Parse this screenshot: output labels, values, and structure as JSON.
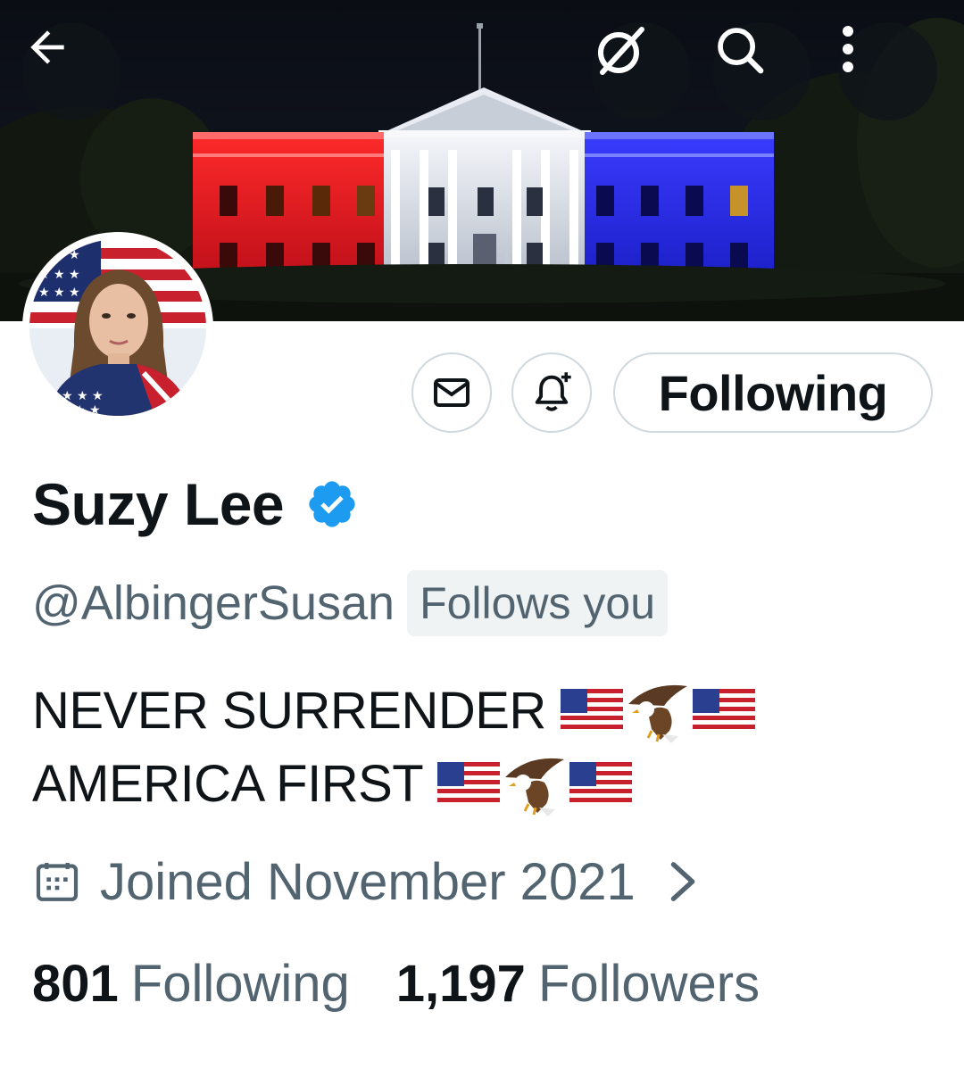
{
  "header": {
    "back_icon": "arrow-left-icon",
    "grok_icon": "grok-icon",
    "search_icon": "search-icon",
    "more_icon": "more-vertical-icon"
  },
  "profile": {
    "display_name": "Suzy Lee",
    "verified": true,
    "handle": "@AlbingerSusan",
    "follows_you": "Follows you",
    "bio_lines": [
      {
        "text": "NEVER SURRENDER",
        "emoji": "🇺🇸🦅🇺🇸"
      },
      {
        "text": "AMERICA FIRST",
        "emoji": "🇺🇸🦅🇺🇸"
      }
    ],
    "joined": "Joined November 2021"
  },
  "actions": {
    "message_icon": "envelope-icon",
    "notify_icon": "bell-plus-icon",
    "following_label": "Following"
  },
  "stats": {
    "following_count": "801",
    "following_label": "Following",
    "followers_count": "1,197",
    "followers_label": "Followers"
  },
  "colors": {
    "text_primary": "#0f1419",
    "text_secondary": "#536471",
    "verified_blue": "#1d9bf0",
    "border": "#cfd9de",
    "badge_bg": "#eff3f4"
  }
}
